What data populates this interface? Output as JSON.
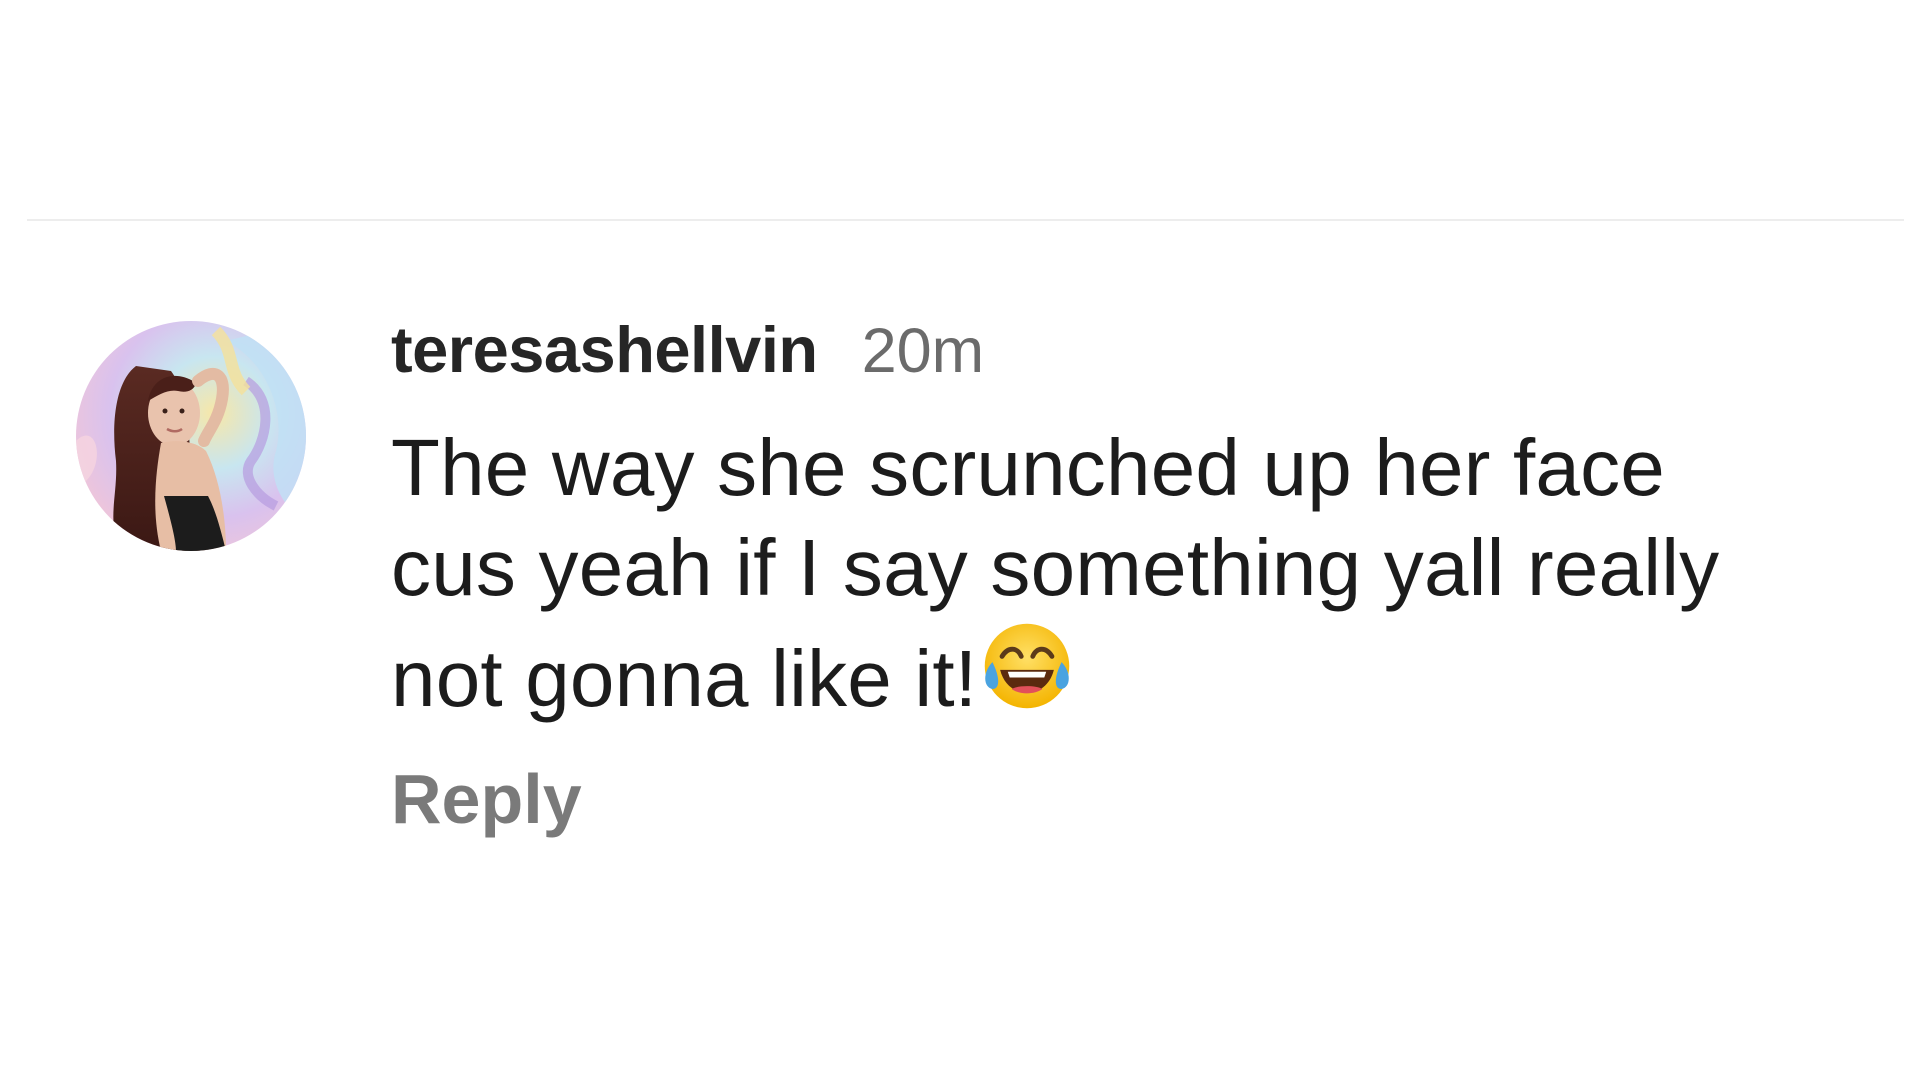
{
  "comment": {
    "username": "teresashellvin",
    "time": "20m",
    "text_lines": [
      "The way she scrunched up her face",
      "cus yeah if I say something yall really",
      "not gonna like it!"
    ],
    "emoji": "face-with-tears-of-joy-icon",
    "reply_label": "Reply",
    "avatar": "profile-photo"
  },
  "colors": {
    "username": "#262626",
    "time": "#6b6b6b",
    "text": "#1c1c1c",
    "reply": "#7a7a7a",
    "divider": "#ededed"
  }
}
